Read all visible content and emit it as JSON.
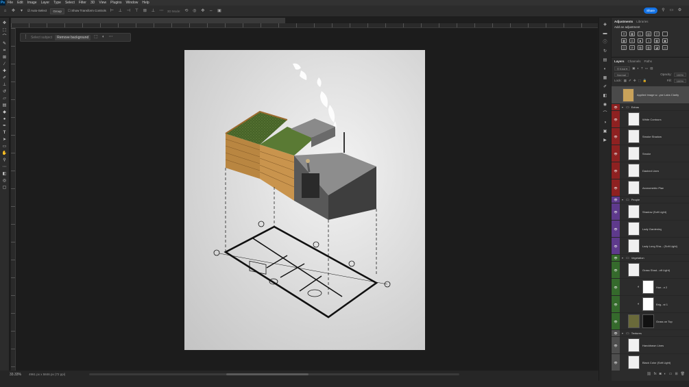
{
  "menu": [
    "File",
    "Edit",
    "Image",
    "Layer",
    "Type",
    "Select",
    "Filter",
    "3D",
    "View",
    "Plugins",
    "Window",
    "Help"
  ],
  "logo": "Ps",
  "options": {
    "auto_select": "Auto-Select",
    "group": "Group",
    "show_transform": "Show Transform Controls",
    "mode_3d": "3D Mode:",
    "share": "Share"
  },
  "context_bar": {
    "select_subject": "Select subject",
    "remove_background": "Remove background"
  },
  "status": {
    "zoom": "33.33%",
    "dims": "4961 px x 5846 px (72 ppi)"
  },
  "adjustments": {
    "tabs": [
      "Adjustments",
      "Libraries"
    ],
    "title": "Add an adjustment",
    "icons": [
      "☀",
      "▦",
      "◐",
      "▤",
      "▽",
      "",
      "▦",
      "⚖",
      "■",
      "◑",
      "▦",
      "▣",
      "◫",
      "⊘",
      "▨",
      "▥",
      "◪",
      "▭"
    ]
  },
  "layers_panel": {
    "tabs": [
      "Layers",
      "Channels",
      "Paths"
    ],
    "kind": "Kind",
    "blend": "Normal",
    "opacity_label": "Opacity:",
    "opacity": "100%",
    "lock_label": "Lock:",
    "fill_label": "Fill:",
    "fill": "100%"
  },
  "layers": [
    {
      "name": "Applied Image w...yse Labs Clarity",
      "type": "layer",
      "color": "none",
      "selected": true
    },
    {
      "name": "Extras",
      "type": "group",
      "color": "red"
    },
    {
      "name": "White Contours",
      "type": "layer",
      "color": "red"
    },
    {
      "name": "Smoke Shadow",
      "type": "layer",
      "color": "red"
    },
    {
      "name": "Smoke",
      "type": "layer",
      "color": "red"
    },
    {
      "name": "Dashed Lines",
      "type": "layer",
      "color": "red"
    },
    {
      "name": "Axonometric Plan",
      "type": "layer",
      "color": "red"
    },
    {
      "name": "People",
      "type": "group",
      "color": "purple"
    },
    {
      "name": "Shadow (Soft Light)",
      "type": "layer",
      "color": "purple"
    },
    {
      "name": "Lady Gardening",
      "type": "layer",
      "color": "purple",
      "underline": true
    },
    {
      "name": "Lady Long Sha... (Soft Light)",
      "type": "layer",
      "color": "purple"
    },
    {
      "name": "Vegetation",
      "type": "group",
      "color": "green"
    },
    {
      "name": "Grass Shad...oft Light)",
      "type": "layer",
      "color": "green"
    },
    {
      "name": "Hue...n 2",
      "type": "adjust",
      "color": "green"
    },
    {
      "name": "Brig...st 1",
      "type": "adjust",
      "color": "green"
    },
    {
      "name": "Grass on Top",
      "type": "masked",
      "color": "green",
      "underline": true
    },
    {
      "name": "Textures",
      "type": "group",
      "color": "gray"
    },
    {
      "name": "Handdrawn Lines",
      "type": "layer",
      "color": "gray"
    },
    {
      "name": "Black Color (Soft Light)",
      "type": "layer",
      "color": "gray"
    }
  ]
}
